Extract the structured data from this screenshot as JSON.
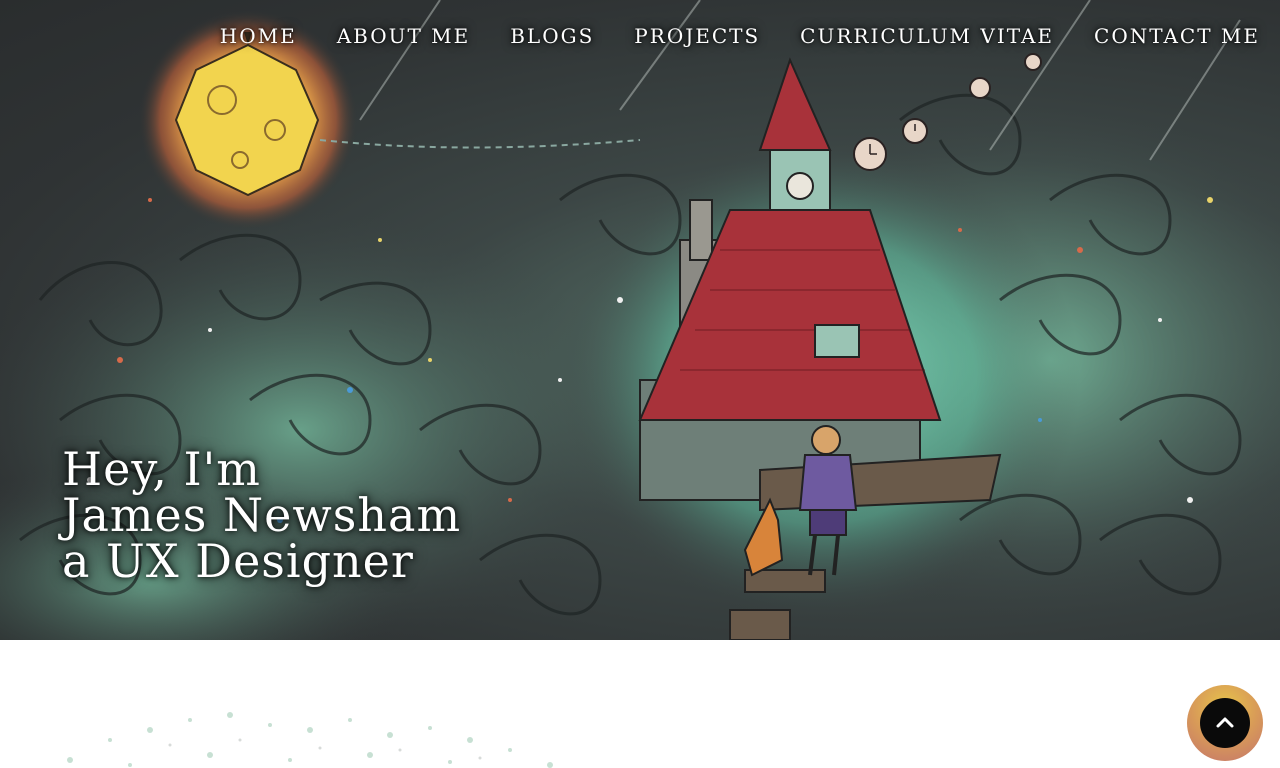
{
  "nav": {
    "items": [
      {
        "label": "HOME"
      },
      {
        "label": "ABOUT ME"
      },
      {
        "label": "BLOGS"
      },
      {
        "label": "PROJECTS"
      },
      {
        "label": "CURRICULUM VITAE"
      },
      {
        "label": "CONTACT ME"
      }
    ]
  },
  "hero": {
    "line1": "Hey, I'm",
    "line2": "James Newsham",
    "line3": "a UX Designer"
  },
  "scroll_top": {
    "icon": "chevron-up-icon"
  },
  "colors": {
    "sky": "#2f3334",
    "mint_glow": "#6fd8b8",
    "moon": "#f4d34a",
    "roof": "#a8323a",
    "nav_text": "#ffffff",
    "button_ring": "#e0b04c",
    "button_core": "#0a0a0a"
  }
}
